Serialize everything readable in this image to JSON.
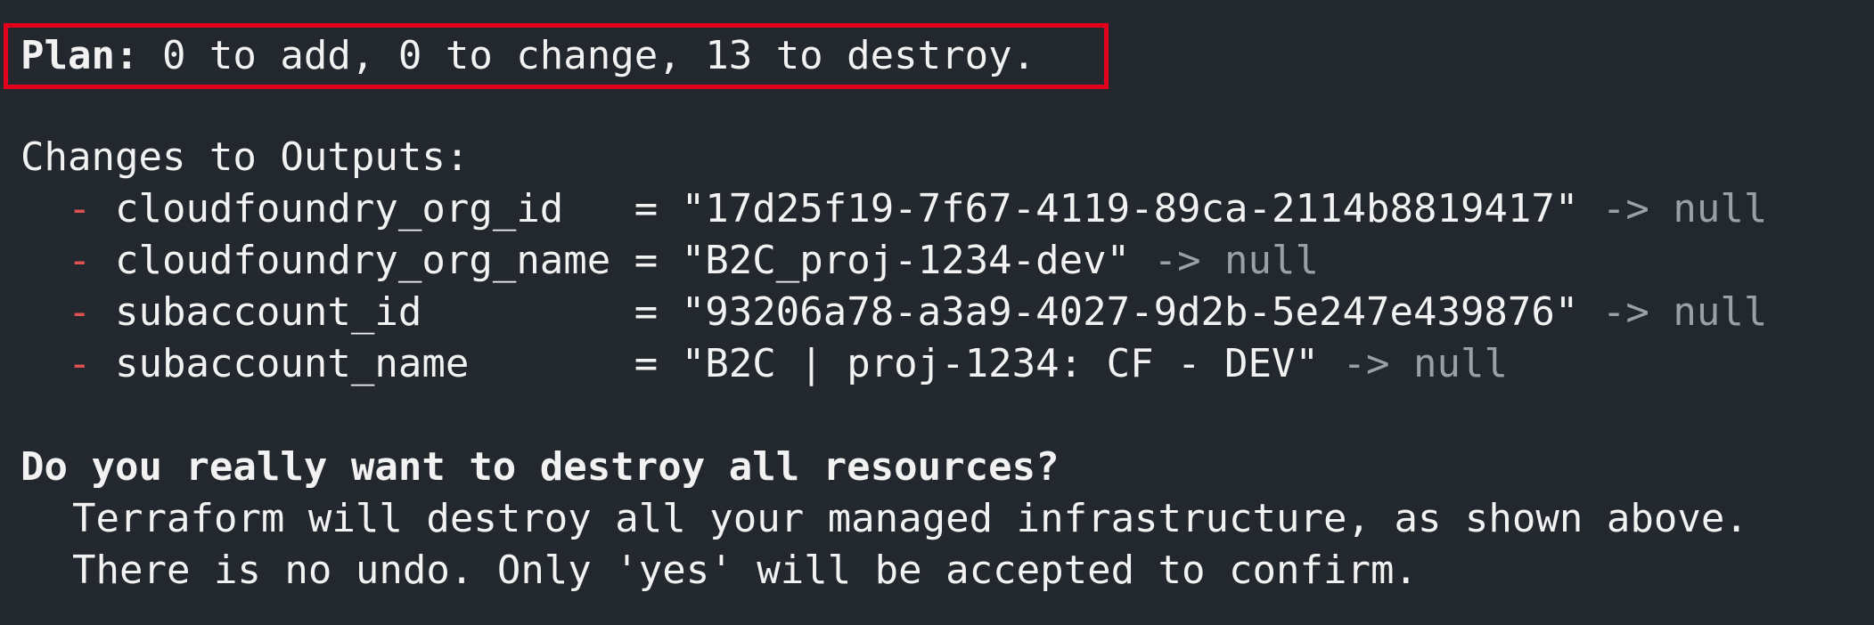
{
  "plan": {
    "label": "Plan:",
    "summary": " 0 to add, 0 to change, 13 to destroy."
  },
  "outputs": {
    "header": "Changes to Outputs:",
    "items": [
      {
        "marker": "-",
        "name": "cloudfoundry_org_id  ",
        "eq": " = ",
        "value": "\"17d25f19-7f67-4119-89ca-2114b8819417\"",
        "change": " -> null"
      },
      {
        "marker": "-",
        "name": "cloudfoundry_org_name",
        "eq": " = ",
        "value": "\"B2C_proj-1234-dev\"",
        "change": " -> null"
      },
      {
        "marker": "-",
        "name": "subaccount_id        ",
        "eq": " = ",
        "value": "\"93206a78-a3a9-4027-9d2b-5e247e439876\"",
        "change": " -> null"
      },
      {
        "marker": "-",
        "name": "subaccount_name      ",
        "eq": " = ",
        "value": "\"B2C | proj-1234: CF - DEV\"",
        "change": " -> null"
      }
    ]
  },
  "prompt": {
    "question": "Do you really want to destroy all resources?",
    "line1": "Terraform will destroy all your managed infrastructure, as shown above.",
    "line2": "There is no undo. Only 'yes' will be accepted to confirm."
  },
  "colors": {
    "background": "#23272e",
    "highlight": "#e3001b",
    "destroy_marker": "#e05252",
    "dim": "#9aa0a8"
  }
}
